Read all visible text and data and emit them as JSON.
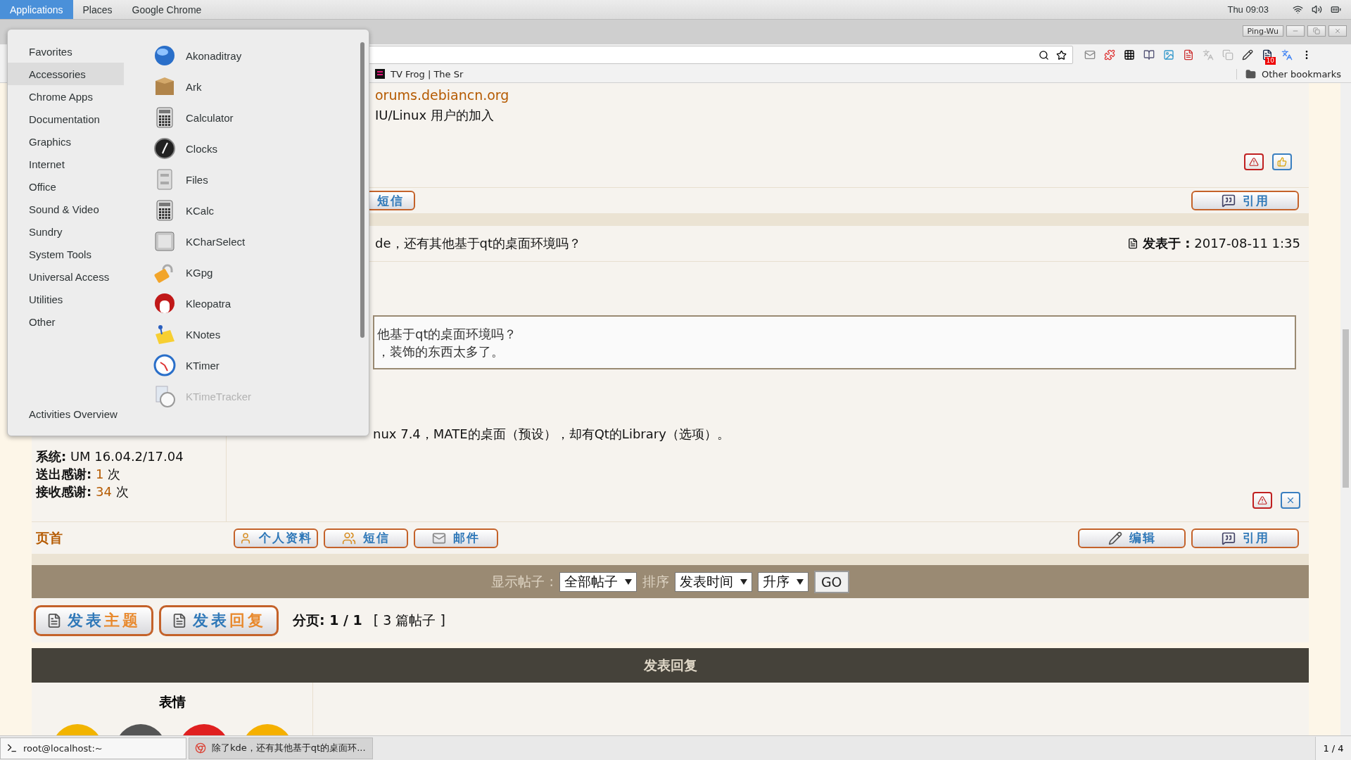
{
  "top_bar": {
    "menus": [
      {
        "label": "Applications",
        "selected": true
      },
      {
        "label": "Places",
        "selected": false
      },
      {
        "label": "Google Chrome",
        "selected": false
      }
    ],
    "clock": "Thu 09:03"
  },
  "browser": {
    "profile": "Ping-Wu",
    "extension_badge": "10",
    "bookmarks": [
      {
        "label": "TV Frog | The Sr"
      }
    ],
    "other_bookmarks": "Other bookmarks"
  },
  "first_post": {
    "link": "orums.debiancn.org",
    "text": "IU/Linux 用户的加入",
    "post_icons": [
      {
        "kind": "report"
      },
      {
        "kind": "thanks"
      }
    ],
    "buttons": [
      {
        "label": "短信"
      }
    ],
    "right_buttons": [
      {
        "kind": "quote",
        "label": "引用"
      }
    ]
  },
  "second_post": {
    "title": "de，还有其他基于qt的桌面环境吗？",
    "posted_label": "发表于 :",
    "posted_at": "2017-08-11 1:35",
    "quote_lines": [
      "他基于qt的桌面环境吗？",
      "，装饰的东西太多了。"
    ],
    "body": "nux 7.4，MATE的桌面（预设），却有Qt的Library（选项）。",
    "profile": [
      {
        "label": "系统:",
        "value": "UM 16.04.2/17.04",
        "highlight": false
      },
      {
        "label": "送出感谢:",
        "value": "1",
        "suffix": "次",
        "highlight": true
      },
      {
        "label": "接收感谢:",
        "value": "34",
        "suffix": "次",
        "highlight": true
      }
    ],
    "post_icons": [
      {
        "kind": "report"
      },
      {
        "kind": "delete"
      }
    ],
    "top_link": "页首",
    "buttons": [
      {
        "kind": "profile",
        "label": "个人资料"
      },
      {
        "kind": "pm",
        "label": "短信"
      },
      {
        "kind": "email",
        "label": "邮件"
      }
    ],
    "right_buttons": [
      {
        "kind": "edit",
        "label": "编辑"
      },
      {
        "kind": "quote",
        "label": "引用"
      }
    ]
  },
  "display_bar": {
    "label": "显示帖子 :",
    "filter": "全部帖子",
    "sort_label": "排序",
    "sort": "发表时间",
    "order": "升序",
    "go": "GO"
  },
  "actions": {
    "buttons": [
      {
        "prefix": "发表",
        "highlight": "主题"
      },
      {
        "prefix": "发表",
        "highlight": "回复"
      }
    ],
    "pagination_label": "分页:",
    "pagination": "1 / 1",
    "count": "[ 3 篇帖子 ]"
  },
  "reply": {
    "title": "发表回复",
    "smilies_label": "表情"
  },
  "menu": {
    "categories": [
      {
        "label": "Favorites",
        "selected": false
      },
      {
        "label": "Accessories",
        "selected": true
      },
      {
        "label": "Chrome Apps",
        "selected": false
      },
      {
        "label": "Documentation",
        "selected": false
      },
      {
        "label": "Graphics",
        "selected": false
      },
      {
        "label": "Internet",
        "selected": false
      },
      {
        "label": "Office",
        "selected": false
      },
      {
        "label": "Sound & Video",
        "selected": false
      },
      {
        "label": "Sundry",
        "selected": false
      },
      {
        "label": "System Tools",
        "selected": false
      },
      {
        "label": "Universal Access",
        "selected": false
      },
      {
        "label": "Utilities",
        "selected": false
      },
      {
        "label": "Other",
        "selected": false
      }
    ],
    "activities": "Activities Overview",
    "apps": [
      {
        "label": "Akonaditray",
        "kind": "globe",
        "faded": false
      },
      {
        "label": "Ark",
        "kind": "box",
        "faded": false
      },
      {
        "label": "Calculator",
        "kind": "calculator",
        "faded": false
      },
      {
        "label": "Clocks",
        "kind": "clock",
        "faded": false
      },
      {
        "label": "Files",
        "kind": "cabinet",
        "faded": false
      },
      {
        "label": "KCalc",
        "kind": "calculator",
        "faded": false
      },
      {
        "label": "KCharSelect",
        "kind": "key",
        "faded": false
      },
      {
        "label": "KGpg",
        "kind": "lock",
        "faded": false
      },
      {
        "label": "Kleopatra",
        "kind": "redhead",
        "faded": false
      },
      {
        "label": "KNotes",
        "kind": "note",
        "faded": false
      },
      {
        "label": "KTimer",
        "kind": "timer",
        "faded": false
      },
      {
        "label": "KTimeTracker",
        "kind": "tracker",
        "faded": true
      }
    ]
  },
  "taskbar": {
    "windows": [
      {
        "label": "root@localhost:~",
        "kind": "terminal",
        "selected": false
      },
      {
        "label": "除了kde，还有其他基于qt的桌面环...",
        "kind": "browser",
        "selected": true
      }
    ],
    "workspace": "1 / 4"
  }
}
